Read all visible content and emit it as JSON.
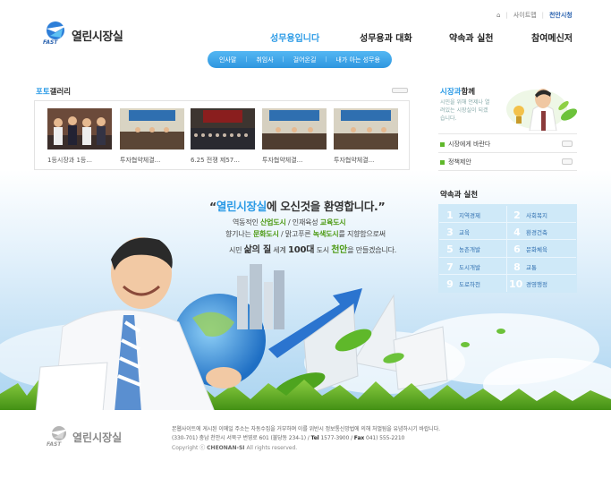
{
  "header": {
    "logo_text": "열린시장실",
    "logo_tag": "FAST",
    "util_links": [
      "홈",
      "사이트맵",
      "천안시청"
    ],
    "gnb": [
      "성무용입니다",
      "성무용과 대화",
      "약속과 실천",
      "참여메신저"
    ],
    "gnb_active_index": 0,
    "sub_menu": [
      "인사말",
      "취임사",
      "걸어온길",
      "내가 아는 성무용"
    ]
  },
  "gallery": {
    "title_prefix": "포토",
    "title_suffix": "갤러리",
    "captions": [
      "1등시장과 1등...",
      "투자협약체결...",
      "6.25 전쟁 제57...",
      "투자협약체결...",
      "투자협약체결..."
    ]
  },
  "right": {
    "mayor_title_prefix": "시장과",
    "mayor_title_suffix": "함께",
    "mayor_desc": "시민을 위해 언제나 열려있는 시장실이 되겠습니다.",
    "links": [
      "시장에게 바란다",
      "정책제안"
    ],
    "pledge_title": "약속과 실천",
    "pledges": [
      {
        "n": "1",
        "label": "지역경제"
      },
      {
        "n": "2",
        "label": "사회복지"
      },
      {
        "n": "3",
        "label": "교육"
      },
      {
        "n": "4",
        "label": "환경건축"
      },
      {
        "n": "5",
        "label": "농촌개발"
      },
      {
        "n": "6",
        "label": "문화체육"
      },
      {
        "n": "7",
        "label": "도시개발"
      },
      {
        "n": "8",
        "label": "교통"
      },
      {
        "n": "9",
        "label": "도로하천"
      },
      {
        "n": "10",
        "label": "경영행정"
      }
    ]
  },
  "hero": {
    "quote_open": "“",
    "quote_blue": "열린시장실",
    "quote_rest": "에 오신것을 환영합니다.”",
    "line1": {
      "a": "역동적인 ",
      "b": "산업도시",
      "c": " / 인재육성 ",
      "d": "교육도시"
    },
    "line2": {
      "a": "향기나는 ",
      "b": "문화도시",
      "c": " / 맑고푸른 ",
      "d": "녹색도시",
      "e": "를 지향함으로써"
    },
    "line3": {
      "a": "시민 ",
      "b": "삶의 질",
      "c": " 세계 ",
      "d": "100대",
      "e": " 도시 ",
      "f": "천안",
      "g": "을 만들겠습니다."
    }
  },
  "footer": {
    "logo_text": "열린시장실",
    "logo_tag": "FAST",
    "notice": "본웹사이트에 게시된 이메일 주소는 자동수집을 거부하며 이를 위반시 정보통신망법에 의해 처벌됨을 유념하시기 바랍니다.",
    "address": "(330-701) 충남 천안시 서북구 번영로 601 (불당동 234-1)",
    "tel_label": "Tel",
    "tel": "1577-3900",
    "fax_label": "Fax",
    "fax": "041) 555-2210",
    "copyright_prefix": "Copyright ⓒ",
    "copyright_org": "CHEONAN-SI",
    "copyright_suffix": "All rights reserved."
  },
  "colors": {
    "accent": "#2a9ae6",
    "green": "#4d9a14",
    "pledge_bg": "#cfe9f8"
  }
}
